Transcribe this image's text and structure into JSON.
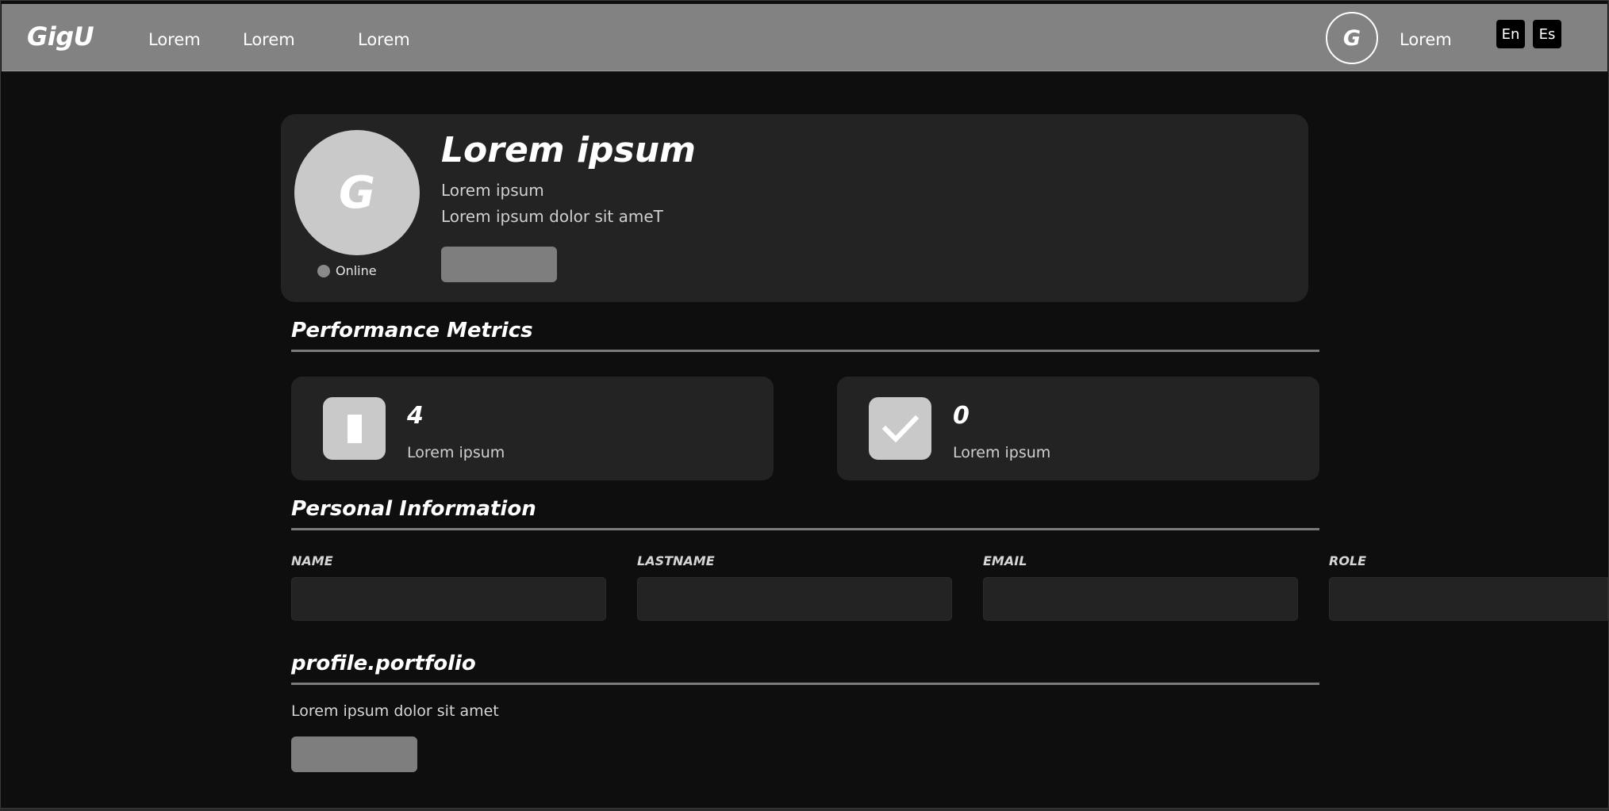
{
  "navbar": {
    "brand": "GigU",
    "links": [
      "Lorem",
      "Lorem",
      "Lorem"
    ],
    "avatar_initial": "G",
    "user_label": "Lorem",
    "languages": [
      "En",
      "Es"
    ]
  },
  "profile": {
    "avatar_initial": "G",
    "status": "Online",
    "name": "Lorem ipsum",
    "subtitle": "Lorem ipsum",
    "description": "Lorem ipsum dolor sit ameT"
  },
  "performance": {
    "title": "Performance Metrics",
    "metrics": [
      {
        "value": "4",
        "label": "Lorem ipsum",
        "icon": "document-icon"
      },
      {
        "value": "0",
        "label": "Lorem ipsum",
        "icon": "checkmark-icon"
      }
    ]
  },
  "personal": {
    "title": "Personal Information",
    "fields": [
      {
        "label": "NAME",
        "value": ""
      },
      {
        "label": "LASTNAME",
        "value": ""
      },
      {
        "label": "EMAIL",
        "value": ""
      },
      {
        "label": "ROLE",
        "value": ""
      }
    ]
  },
  "portfolio": {
    "title": "profile.portfolio",
    "text": "Lorem ipsum dolor sit amet"
  }
}
